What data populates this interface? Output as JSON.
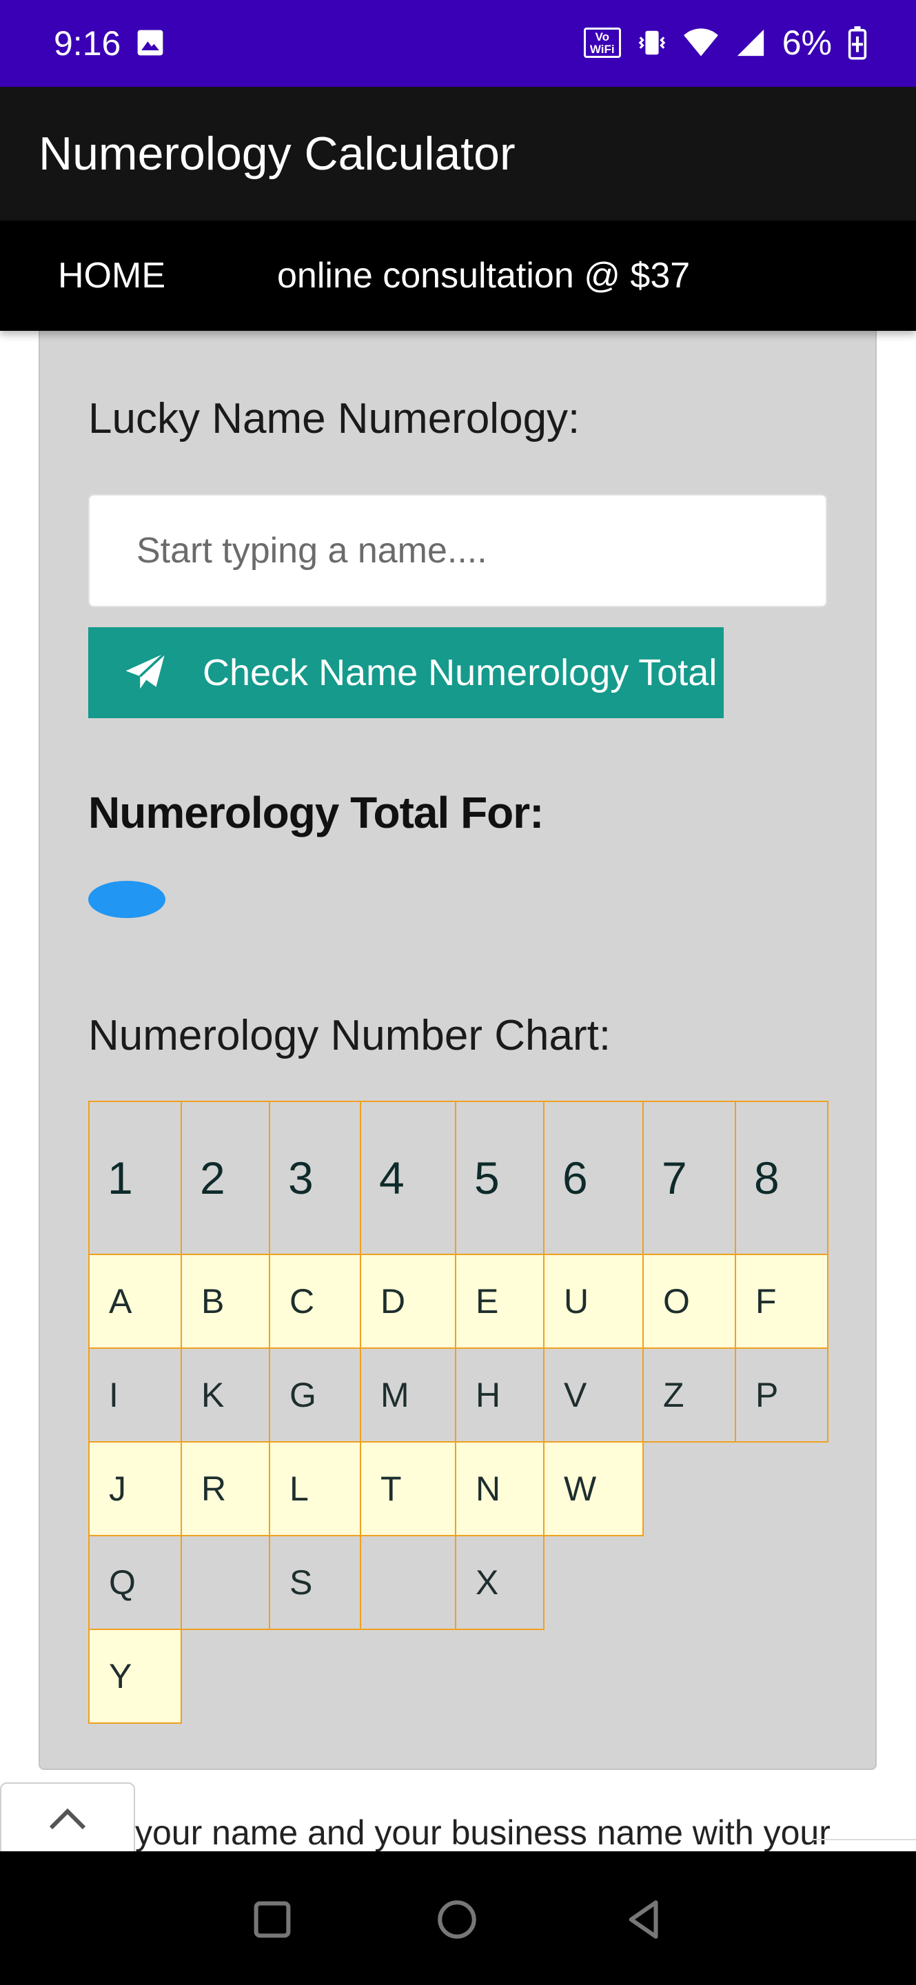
{
  "status_bar": {
    "time": "9:16",
    "battery_percent": "6%",
    "wifi_badge": "Vo WiFi",
    "icons": [
      "gallery-icon",
      "vowifi-icon",
      "vibrate-icon",
      "wifi-icon",
      "signal-icon",
      "battery-charging-icon"
    ]
  },
  "app_bar": {
    "title": "Numerology Calculator"
  },
  "nav": {
    "home": "HOME",
    "consultation": "online consultation @ $37"
  },
  "form": {
    "section_title": "Lucky Name Numerology:",
    "name_placeholder": "Start typing a name....",
    "name_value": "",
    "check_button_label": "Check Name Numerology Total",
    "check_button_icon": "paper-plane-icon"
  },
  "result": {
    "title": "Numerology Total For:",
    "value": ""
  },
  "chart": {
    "title": "Numerology Number Chart:",
    "headers": [
      "1",
      "2",
      "3",
      "4",
      "5",
      "6",
      "7",
      "8"
    ],
    "rows": [
      [
        "A",
        "B",
        "C",
        "D",
        "E",
        "U",
        "O",
        "F"
      ],
      [
        "I",
        "K",
        "G",
        "M",
        "H",
        "V",
        "Z",
        "P"
      ],
      [
        "J",
        "R",
        "L",
        "T",
        "N",
        "W"
      ],
      [
        "Q",
        "",
        "S",
        "",
        "X"
      ],
      [
        "Y"
      ]
    ]
  },
  "bottom": {
    "peek_text": "your name and your business name with your",
    "scroll_top_icon": "chevron-up-icon"
  },
  "colors": {
    "status_bar": "#3a00b5",
    "app_bar": "#141414",
    "nav_bar": "#000000",
    "card": "#d4d4d4",
    "button": "#159a8c",
    "badge": "#2196f3",
    "chart_border": "#f0a020",
    "chart_light_row": "#fffed8"
  }
}
